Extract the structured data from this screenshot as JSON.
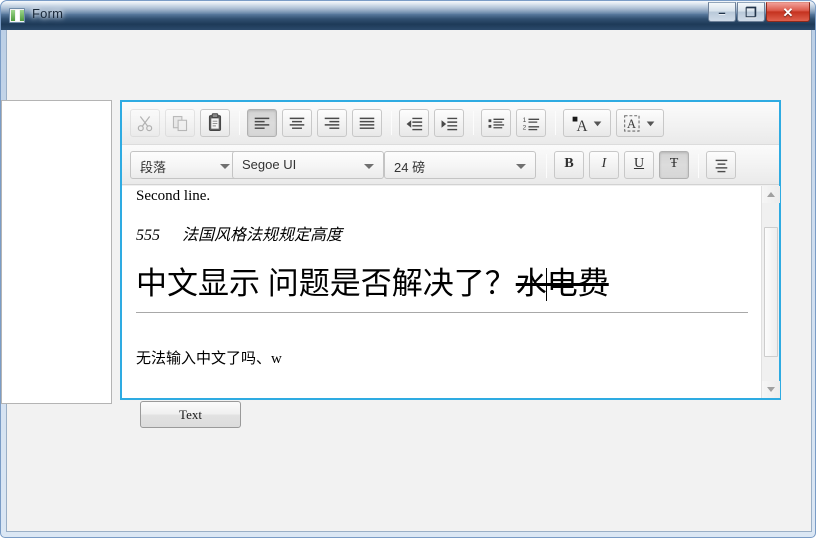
{
  "window": {
    "title": "Form",
    "icon": "form-window-icon",
    "caption_buttons": {
      "minimize": "–",
      "maximize": "❐",
      "close": "✕"
    }
  },
  "left_panel": {
    "name": "empty-white-panel",
    "content": ""
  },
  "editor": {
    "focus_border_color": "#2eabe2",
    "toolbar_row_1": [
      {
        "id": "cut",
        "icon": "scissors-icon",
        "label": "",
        "state": "disabled"
      },
      {
        "id": "copy",
        "icon": "copy-icon",
        "label": "",
        "state": "disabled"
      },
      {
        "id": "paste",
        "icon": "clipboard-paste-icon",
        "label": "",
        "state": "normal"
      },
      {
        "id": "align-left",
        "icon": "align-left-icon",
        "label": "",
        "state": "pressed"
      },
      {
        "id": "align-center",
        "icon": "align-center-icon",
        "label": "",
        "state": "normal"
      },
      {
        "id": "align-right",
        "icon": "align-right-icon",
        "label": "",
        "state": "normal"
      },
      {
        "id": "align-justify",
        "icon": "align-justify-icon",
        "label": "",
        "state": "normal"
      },
      {
        "id": "outdent",
        "icon": "decrease-indent-icon",
        "label": "",
        "state": "normal"
      },
      {
        "id": "indent",
        "icon": "increase-indent-icon",
        "label": "",
        "state": "normal"
      },
      {
        "id": "bullet-list",
        "icon": "bullet-list-icon",
        "label": "",
        "state": "normal"
      },
      {
        "id": "numbered-list",
        "icon": "numbered-list-icon",
        "label": "",
        "state": "normal"
      },
      {
        "id": "font-color",
        "icon": "font-color-icon",
        "label": "A",
        "state": "normal"
      },
      {
        "id": "highlight",
        "icon": "text-highlight-icon",
        "label": "A",
        "state": "normal"
      }
    ],
    "toolbar_row_2": {
      "paragraph_style": {
        "value": "段落",
        "name": "paragraph-style-combo"
      },
      "font_family": {
        "value": "Segoe UI",
        "name": "font-family-combo"
      },
      "font_size": {
        "value": "24 磅",
        "name": "font-size-combo"
      },
      "bold": {
        "label": "B",
        "state": "normal"
      },
      "italic": {
        "label": "I",
        "state": "normal"
      },
      "underline": {
        "label": "U",
        "state": "normal"
      },
      "strikethrough": {
        "label": "Ŧ",
        "state": "pressed"
      },
      "line_spacing": {
        "icon": "line-spacing-icon",
        "state": "normal"
      }
    },
    "document": {
      "line_1": "Second line.",
      "line_2_number": "555",
      "line_2_text": "法国风格法规规定高度",
      "line_3_plain": "中文显示  问题是否解决了？",
      "line_3_struck_a": "水",
      "line_3_struck_b": "电费",
      "line_4": "无法输入中文了吗、",
      "line_4_tail": "w"
    },
    "scrollbar": {
      "up_arrow": "▲",
      "down_arrow": "▼"
    }
  },
  "buttons": {
    "text_button": "Text"
  }
}
